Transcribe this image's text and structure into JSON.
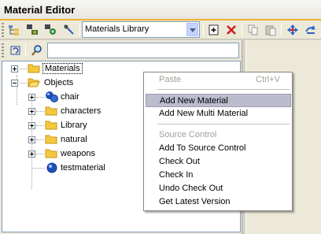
{
  "window": {
    "title": "Material Editor"
  },
  "toolbar": {
    "library_select": "Materials Library",
    "buttons": [
      "library-tree-icon",
      "material-list-icon",
      "add-material-icon",
      "pick-icon",
      "new-icon",
      "delete-icon",
      "copy-icon",
      "paste-icon",
      "assign-icon",
      "refresh-icon"
    ]
  },
  "tree": {
    "nodes": [
      {
        "label": "Materials",
        "expand": "plus"
      },
      {
        "label": "Objects",
        "expand": "minus"
      },
      {
        "label": "chair",
        "expand": "plus"
      },
      {
        "label": "characters",
        "expand": "plus"
      },
      {
        "label": "Library",
        "expand": "plus"
      },
      {
        "label": "natural",
        "expand": "plus"
      },
      {
        "label": "weapons",
        "expand": "plus"
      },
      {
        "label": "testmaterial",
        "expand": "none"
      }
    ]
  },
  "context_menu": {
    "paste": "Paste",
    "paste_shortcut": "Ctrl+V",
    "add_new_material": "Add New Material",
    "add_new_multi_material": "Add New Multi Material",
    "source_control": "Source Control",
    "add_to_source_control": "Add To Source Control",
    "check_out": "Check Out",
    "check_in": "Check In",
    "undo_check_out": "Undo Check Out",
    "get_latest_version": "Get Latest Version"
  },
  "colors": {
    "title_accent": "#f2b136",
    "menu_highlight": "#bcbcce",
    "disabled_text": "#a19e96"
  }
}
